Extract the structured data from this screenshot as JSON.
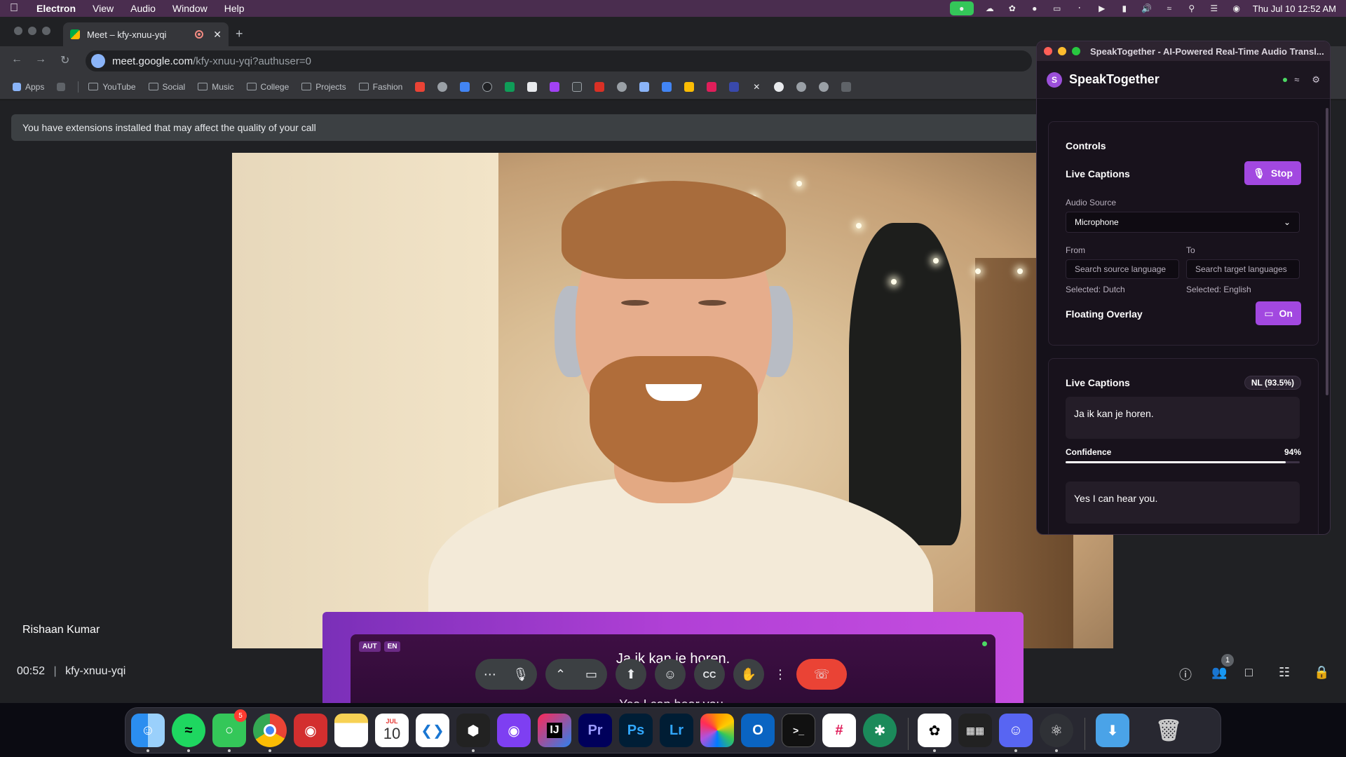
{
  "menubar": {
    "app": "Electron",
    "items": [
      "View",
      "Audio",
      "Window",
      "Help"
    ],
    "clock": "Thu Jul 10  12:52 AM"
  },
  "browser": {
    "tab_title": "Meet – kfy-xnuu-yqi",
    "url_host": "meet.google.com",
    "url_path": "/kfy-xnuu-yqi?authuser=0",
    "bookmarks": [
      "Apps",
      "YouTube",
      "Social",
      "Music",
      "College",
      "Projects",
      "Fashion"
    ]
  },
  "meet": {
    "warning": "You have extensions installed that may affect the quality of your call",
    "participant": "Rishaan Kumar",
    "time": "00:52",
    "meeting_code": "kfy-xnuu-yqi",
    "people_count": "1"
  },
  "overlay": {
    "badge_auto": "AUT",
    "badge_lang": "EN",
    "source_text": "Ja ik kan je horen.",
    "arrow": "▼",
    "target_text": "Yes I can hear you."
  },
  "speaktogether": {
    "window_title": "SpeakTogether - AI-Powered Real-Time Audio Transl...",
    "app_name": "SpeakTogether",
    "logo_letter": "S",
    "controls": {
      "title": "Controls",
      "live_captions_label": "Live Captions",
      "stop_label": "Stop",
      "audio_source_label": "Audio Source",
      "audio_source_value": "Microphone",
      "from_label": "From",
      "to_label": "To",
      "from_placeholder": "Search source language",
      "to_placeholder": "Search target languages",
      "from_selected": "Selected: Dutch",
      "to_selected": "Selected: English",
      "floating_overlay_label": "Floating Overlay",
      "overlay_toggle_label": "On"
    },
    "captions": {
      "title": "Live Captions",
      "lang_badge": "NL (93.5%)",
      "source_text": "Ja ik kan je horen.",
      "confidence_label": "Confidence",
      "confidence_value": "94%",
      "confidence_fraction": 0.94,
      "translated_text": "Yes I can hear you."
    }
  },
  "dock": {
    "calendar_month": "JUL",
    "calendar_day": "10",
    "messages_badge": "5"
  },
  "colors": {
    "accent_purple": "#a248e0",
    "end_call_red": "#ea4335",
    "status_green": "#4cd964"
  }
}
